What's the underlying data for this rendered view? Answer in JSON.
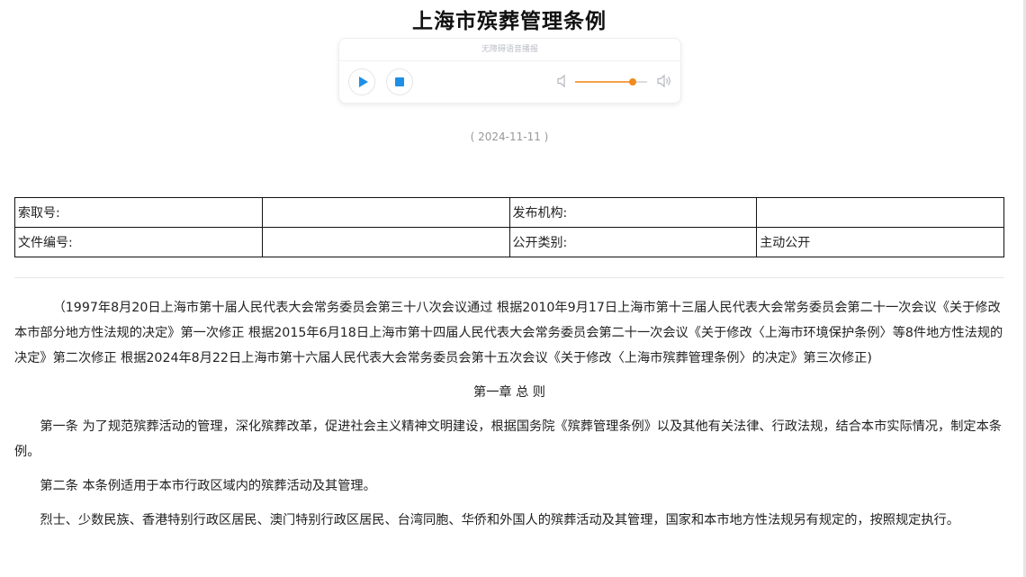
{
  "title": "上海市殡葬管理条例",
  "player": {
    "label": "无障碍语音播报",
    "volume": 0.8
  },
  "date": "( 2024-11-11 )",
  "meta_table": [
    [
      "索取号:",
      "",
      "发布机构:",
      ""
    ],
    [
      "文件编号:",
      "",
      "公开类别:",
      "主动公开"
    ]
  ],
  "content": {
    "preamble": "（1997年8月20日上海市第十届人民代表大会常务委员会第三十八次会议通过 根据2010年9月17日上海市第十三届人民代表大会常务委员会第二十一次会议《关于修改本市部分地方性法规的决定》第一次修正 根据2015年6月18日上海市第十四届人民代表大会常务委员会第二十一次会议《关于修改〈上海市环境保护条例〉等8件地方性法规的决定》第二次修正 根据2024年8月22日上海市第十六届人民代表大会常务委员会第十五次会议《关于修改〈上海市殡葬管理条例〉的决定》第三次修正)",
    "chapter1": "第一章 总 则",
    "article1": "第一条 为了规范殡葬活动的管理，深化殡葬改革，促进社会主义精神文明建设，根据国务院《殡葬管理条例》以及其他有关法律、行政法规，结合本市实际情况，制定本条例。",
    "article2": "第二条 本条例适用于本市行政区域内的殡葬活动及其管理。",
    "article2_p2": "烈士、少数民族、香港特别行政区居民、澳门特别行政区居民、台湾同胞、华侨和外国人的殡葬活动及其管理，国家和本市地方性法规另有规定的，按照规定执行。"
  },
  "colors": {
    "accent": "#1e8fe6",
    "volume": "#f08a1e"
  }
}
